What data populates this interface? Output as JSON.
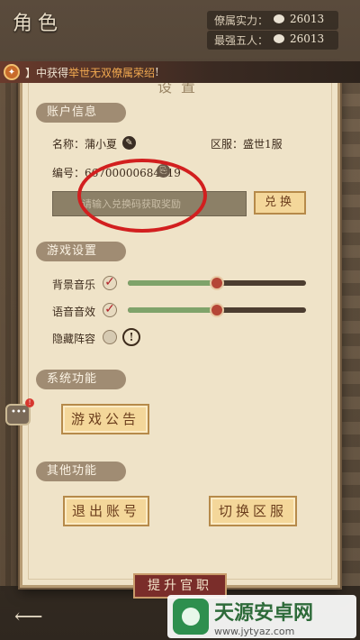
{
  "header": {
    "title": "角色",
    "stat1_label": "僚属实力：",
    "stat1_value": "26013",
    "stat2_label": "最强五人：",
    "stat2_value": "26013"
  },
  "notice": {
    "prefix": "】中获得",
    "highlight": "举世无双僚属荣绍",
    "suffix": "!"
  },
  "panel": {
    "title": "设置",
    "account": {
      "section_label": "账户信息",
      "name_label": "名称：",
      "name_value": "蒲小夏",
      "server_label": "区服：",
      "server_value": "盛世1服",
      "id_label": "编号：",
      "id_value": "66700000684819",
      "redeem_placeholder": "请输入兑换码获取奖励",
      "redeem_button": "兑换"
    },
    "game": {
      "section_label": "游戏设置",
      "bgm_label": "背景音乐",
      "bgm_level": 0.5,
      "voice_label": "语音音效",
      "voice_level": 0.5,
      "hide_label": "隐藏阵容",
      "info_symbol": "!"
    },
    "system": {
      "section_label": "系统功能",
      "announce_button": "游戏公告"
    },
    "other": {
      "section_label": "其他功能",
      "logout_button": "退出账号",
      "switch_button": "切换区服"
    }
  },
  "bottom": {
    "promote_button": "提升官职",
    "back_arrow": "⟵"
  },
  "watermark": {
    "title": "天源安卓网",
    "url": "www.jytyaz.com"
  },
  "colors": {
    "highlight_red": "#d21f1f",
    "slider_fill": "#7fa36a",
    "button_fill": "#f4d79a"
  }
}
